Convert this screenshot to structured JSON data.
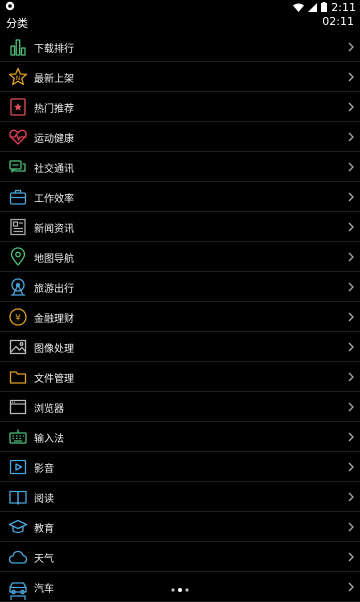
{
  "status_bar": {
    "time": "2:11",
    "icons": [
      "notification-icon",
      "wifi-icon",
      "signal-icon",
      "battery-icon"
    ]
  },
  "header": {
    "title": "分类",
    "time": "02:11"
  },
  "categories": [
    {
      "label": "下载排行",
      "icon": "bar-chart-icon",
      "color": "#4fc07a"
    },
    {
      "label": "最新上架",
      "icon": "new-star-icon",
      "color": "#e0a020"
    },
    {
      "label": "热门推荐",
      "icon": "hot-badge-icon",
      "color": "#e0505a"
    },
    {
      "label": "运动健康",
      "icon": "heartbeat-icon",
      "color": "#e0405a"
    },
    {
      "label": "社交通讯",
      "icon": "chat-bubbles-icon",
      "color": "#4fc07a"
    },
    {
      "label": "工作效率",
      "icon": "briefcase-icon",
      "color": "#4aa8e0"
    },
    {
      "label": "新闻资讯",
      "icon": "newspaper-icon",
      "color": "#aaaaaa"
    },
    {
      "label": "地图导航",
      "icon": "map-pin-icon",
      "color": "#4fc07a"
    },
    {
      "label": "旅游出行",
      "icon": "ferris-wheel-icon",
      "color": "#4aa8e0"
    },
    {
      "label": "金融理财",
      "icon": "yuan-coin-icon",
      "color": "#e0a020"
    },
    {
      "label": "图像处理",
      "icon": "image-icon",
      "color": "#bbbbbb"
    },
    {
      "label": "文件管理",
      "icon": "folder-icon",
      "color": "#e0a020"
    },
    {
      "label": "浏览器",
      "icon": "browser-icon",
      "color": "#bbbbbb"
    },
    {
      "label": "输入法",
      "icon": "keyboard-icon",
      "color": "#4fc07a"
    },
    {
      "label": "影音",
      "icon": "video-play-icon",
      "color": "#4aa8e0"
    },
    {
      "label": "阅读",
      "icon": "book-icon",
      "color": "#4aa8e0"
    },
    {
      "label": "教育",
      "icon": "graduation-cap-icon",
      "color": "#4aa8e0"
    },
    {
      "label": "天气",
      "icon": "cloud-icon",
      "color": "#4aa8e0"
    },
    {
      "label": "汽车",
      "icon": "car-icon",
      "color": "#4aa8e0"
    }
  ],
  "chevron_icon": "chevron-right-icon"
}
